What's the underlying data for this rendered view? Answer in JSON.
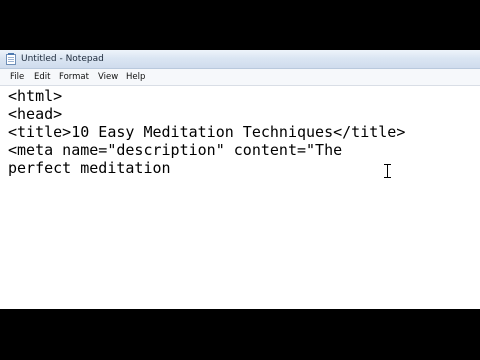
{
  "window": {
    "title": "Untitled - Notepad",
    "app_icon": "notepad-icon"
  },
  "menubar": {
    "items": [
      {
        "label": "File"
      },
      {
        "label": "Edit"
      },
      {
        "label": "Format"
      },
      {
        "label": "View"
      },
      {
        "label": "Help"
      }
    ]
  },
  "editor": {
    "lines": [
      "<html>",
      "<head>",
      "<title>10 Easy Meditation Techniques</title>",
      "<meta name=\"description\" content=\"The",
      "perfect meditation"
    ]
  },
  "colors": {
    "background": "#000000",
    "editor_background": "#ffffff",
    "titlebar": "#dbe6f3",
    "text": "#000000"
  }
}
